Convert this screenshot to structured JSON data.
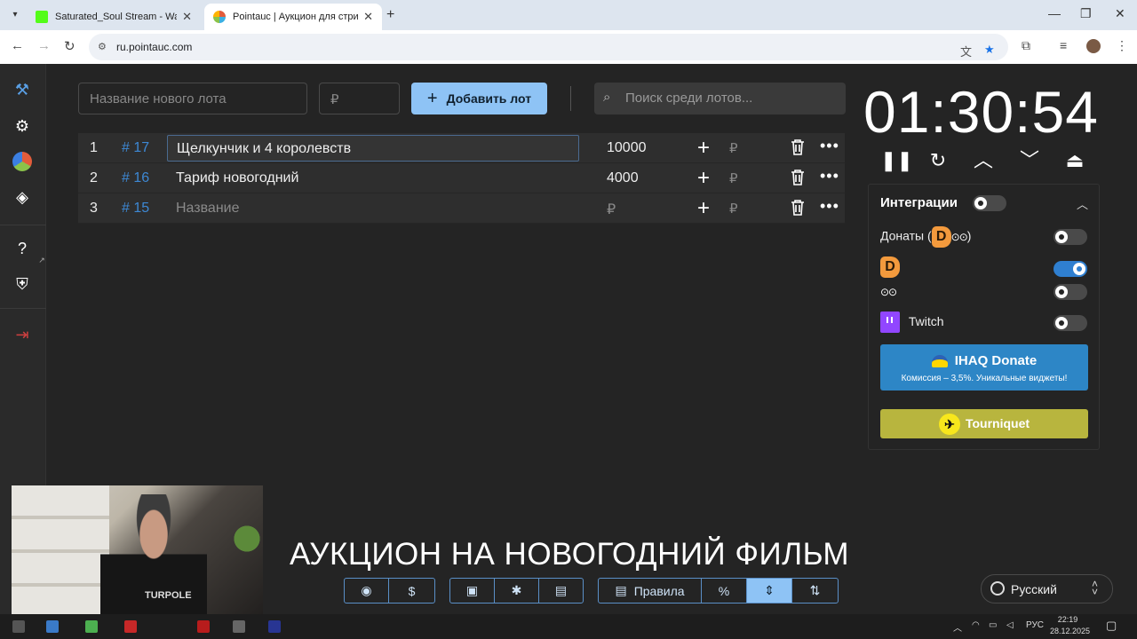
{
  "browser": {
    "tabs": [
      {
        "title": "Saturated_Soul Stream - Watch",
        "favicon_color": "#53fc18"
      },
      {
        "title": "Pointauc | Аукцион для стримеров",
        "favicon_color": "#e25c3b"
      }
    ],
    "url": "ru.pointauc.com"
  },
  "toolbar": {
    "lot_name_placeholder": "Название нового лота",
    "amount_placeholder": "₽",
    "add_label": "Добавить лот",
    "search_placeholder": "Поиск среди лотов..."
  },
  "lots": [
    {
      "num": "1",
      "id": "# 17",
      "name": "Щелкунчик и 4 королевств",
      "amount": "10000",
      "editing": true
    },
    {
      "num": "2",
      "id": "# 16",
      "name": "Тариф новогодний",
      "amount": "4000",
      "editing": false
    },
    {
      "num": "3",
      "id": "# 15",
      "name": "Название",
      "amount": "₽",
      "placeholder": true
    }
  ],
  "currency": "₽",
  "timer": "01:30:54",
  "integrations": {
    "title": "Интеграции",
    "donations_label": "Донаты (",
    "donations_close": ")",
    "twitch_label": "Twitch",
    "ihaq_title": "IHAQ Donate",
    "ihaq_sub": "Комиссия – 3,5%. Уникальные виджеты!",
    "tourniquet": "Tourniquet",
    "donationalerts_enabled": true,
    "accent": "#2f7fd0"
  },
  "caption": "АУКЦИОН НА НОВОГОДНИЙ ФИЛЬМ",
  "bottom": {
    "rules_label": "Правила",
    "percent_label": "%",
    "dollar_label": "$"
  },
  "language": "Русский",
  "taskbar": {
    "lang": "РУС",
    "time": "22:19",
    "date": "28.12.2025"
  },
  "webcam": {
    "shirt_text": "TURPOLE"
  }
}
